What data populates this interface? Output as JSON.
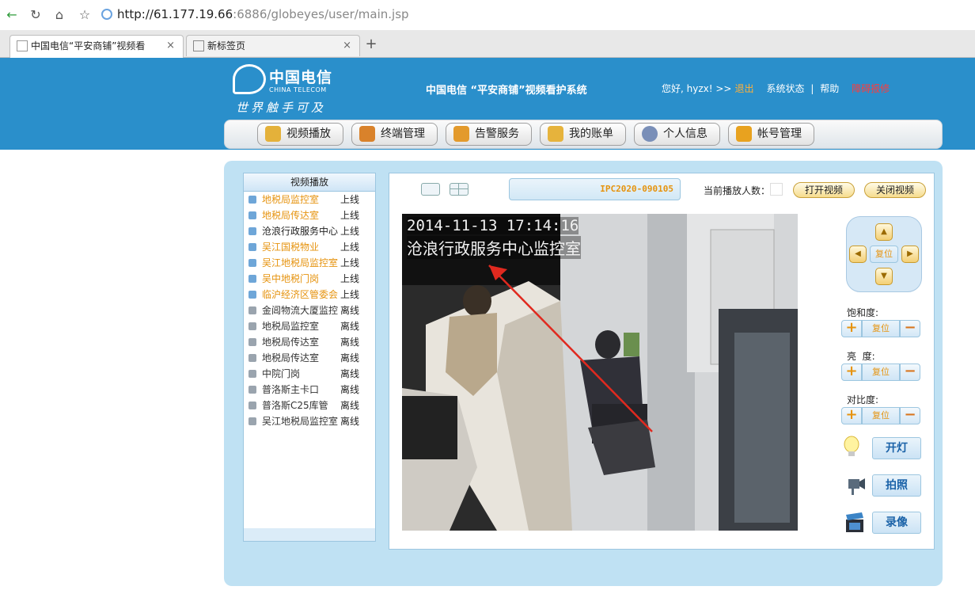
{
  "browser": {
    "url_host": "http://61.177.19.66",
    "url_path": ":6886/globeyes/user/main.jsp",
    "tabs": [
      {
        "label": "中国电信“平安商铺”视频看",
        "close": "×"
      },
      {
        "label": "新标签页",
        "close": "×"
      }
    ],
    "new_tab": "+"
  },
  "header": {
    "logo_cn": "中国电信",
    "logo_en": "CHINA TELECOM",
    "logo_slogan": "世界触手可及",
    "system_title": "中国电信 “平安商铺”视频看护系统",
    "greeting": "您好, hyzx! >>",
    "logout": "退出",
    "system_status": "系统状态",
    "separator": "|",
    "help": "帮助",
    "report": "障碍报修"
  },
  "menu": [
    {
      "label": "视频播放",
      "color": "#e4b13a"
    },
    {
      "label": "终端管理",
      "color": "#d9822b"
    },
    {
      "label": "告警服务",
      "color": "#e39a2c"
    },
    {
      "label": "我的账单",
      "color": "#e6b33c"
    },
    {
      "label": "个人信息",
      "color": "#7a8fb8"
    },
    {
      "label": "帐号管理",
      "color": "#e8a21f"
    }
  ],
  "sidebar": {
    "title": "视频播放",
    "devices": [
      {
        "name": "地税局监控室",
        "status": "上线",
        "state": "online"
      },
      {
        "name": "地税局传达室",
        "status": "上线",
        "state": "online"
      },
      {
        "name": "沧浪行政服务中心",
        "status": "上线",
        "state": "plain"
      },
      {
        "name": "吴江国税物业",
        "status": "上线",
        "state": "online"
      },
      {
        "name": "吴江地税局监控室",
        "status": "上线",
        "state": "online"
      },
      {
        "name": "吴中地税门岗",
        "status": "上线",
        "state": "online"
      },
      {
        "name": "临沪经济区管委会",
        "status": "上线",
        "state": "online"
      },
      {
        "name": "金阊物流大厦监控",
        "status": "离线",
        "state": "offline"
      },
      {
        "name": "地税局监控室",
        "status": "离线",
        "state": "offline"
      },
      {
        "name": "地税局传达室",
        "status": "离线",
        "state": "offline"
      },
      {
        "name": "地税局传达室",
        "status": "离线",
        "state": "offline"
      },
      {
        "name": "中院门岗",
        "status": "离线",
        "state": "offline"
      },
      {
        "name": "普洛斯主卡口",
        "status": "离线",
        "state": "offline"
      },
      {
        "name": "普洛斯C25库管",
        "status": "离线",
        "state": "offline"
      },
      {
        "name": "吴江地税局监控室",
        "status": "离线",
        "state": "offline"
      }
    ]
  },
  "player": {
    "camera_id": "IPC2020-090105",
    "viewer_label": "当前播放人数：",
    "viewer_count": "",
    "open_video": "打开视频",
    "close_video": "关闭视频",
    "osd_time": "2014-11-13 17:14:16",
    "osd_name": "沧浪行政服务中心监控室"
  },
  "controls": {
    "ptz": {
      "up": "▲",
      "down": "▼",
      "left": "◀",
      "right": "▶",
      "reset": "复位"
    },
    "saturation": {
      "label": "饱和度:",
      "plus": "+",
      "reset": "复位",
      "minus": "−"
    },
    "brightness": {
      "label": "亮  度:",
      "plus": "+",
      "reset": "复位",
      "minus": "−"
    },
    "contrast": {
      "label": "对比度:",
      "plus": "+",
      "reset": "复位",
      "minus": "−"
    },
    "light_button": "开灯",
    "snapshot_button": "拍照",
    "record_button": "录像"
  },
  "colors": {
    "header_blue": "#2a8fcb",
    "online_orange": "#e6930e",
    "alert_red": "#ff3b3b"
  }
}
